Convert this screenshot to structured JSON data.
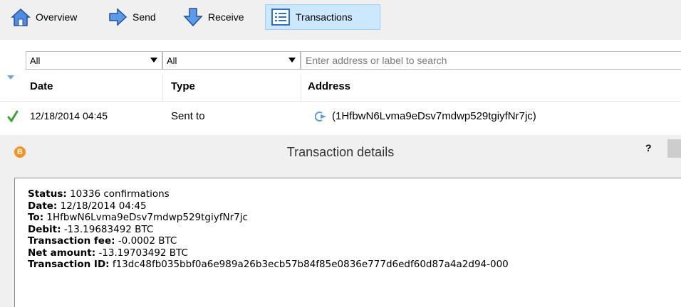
{
  "toolbar": {
    "overview_label": "Overview",
    "send_label": "Send",
    "receive_label": "Receive",
    "transactions_label": "Transactions"
  },
  "filters": {
    "date_filter": "All",
    "type_filter": "All",
    "search_placeholder": "Enter address or label to search"
  },
  "table": {
    "columns": {
      "date": "Date",
      "type": "Type",
      "address": "Address"
    },
    "rows": [
      {
        "date": "12/18/2014 04:45",
        "type": "Sent to",
        "address": "(1HfbwN6Lvma9eDsv7mdwp529tgiyfNr7jc)"
      }
    ]
  },
  "dialog": {
    "title": "Transaction details",
    "help": "?",
    "details": {
      "status_label": "Status:",
      "status_value": "10336 confirmations",
      "date_label": "Date:",
      "date_value": "12/18/2014 04:45",
      "to_label": "To:",
      "to_value": "1HfbwN6Lvma9eDsv7mdwp529tgiyfNr7jc",
      "debit_label": "Debit:",
      "debit_value": "-13.19683492 BTC",
      "fee_label": "Transaction fee:",
      "fee_value": "-0.0002 BTC",
      "net_label": "Net amount:",
      "net_value": "-13.19703492 BTC",
      "txid_label": "Transaction ID:",
      "txid_value": "f13dc48fb035bbf0a6e989a26b3ecb57b84f85e0836e777d6edf60d87a4a2d94-000"
    }
  },
  "colors": {
    "accent": "#cce8ff",
    "bitcoin_orange": "#f7931a",
    "confirmed_green": "#3aa335",
    "icon_blue": "#2f6fd0"
  }
}
